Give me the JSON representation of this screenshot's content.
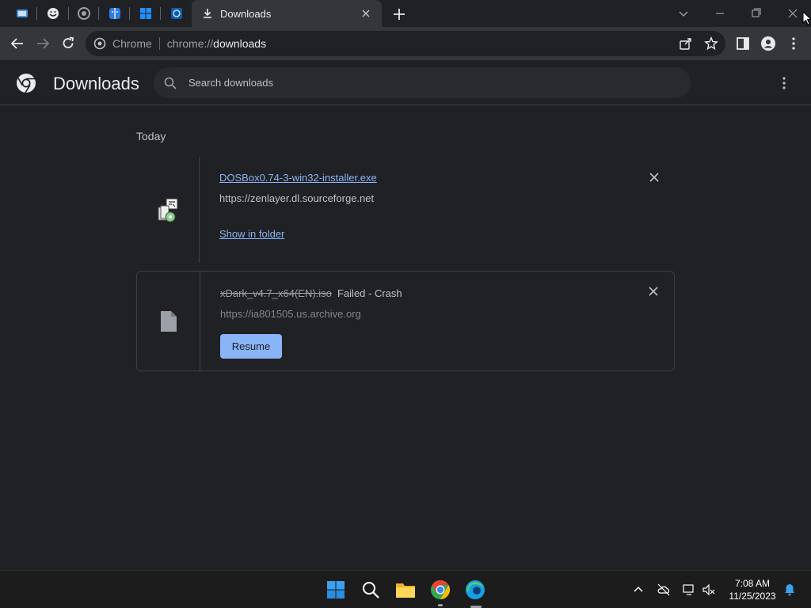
{
  "browser": {
    "tab": {
      "title": "Downloads"
    },
    "omnibox": {
      "origin": "Chrome",
      "url_scheme": "chrome://",
      "url_path": "downloads"
    }
  },
  "page": {
    "title": "Downloads",
    "search_placeholder": "Search downloads"
  },
  "downloads": {
    "date_header": "Today",
    "items": [
      {
        "filename": "DOSBox0.74-3-win32-installer.exe",
        "url": "https://zenlayer.dl.sourceforge.net",
        "action_label": "Show in folder"
      },
      {
        "filename": "xDark_v4.7_x64(EN).iso",
        "status": "Failed - Crash",
        "url": "https://ia801505.us.archive.org",
        "action_label": "Resume"
      }
    ]
  },
  "taskbar": {
    "time": "7:08 AM",
    "date": "11/25/2023"
  },
  "colors": {
    "background": "#202124",
    "link": "#8ab4f8",
    "accent_button": "#8ab4f8"
  }
}
